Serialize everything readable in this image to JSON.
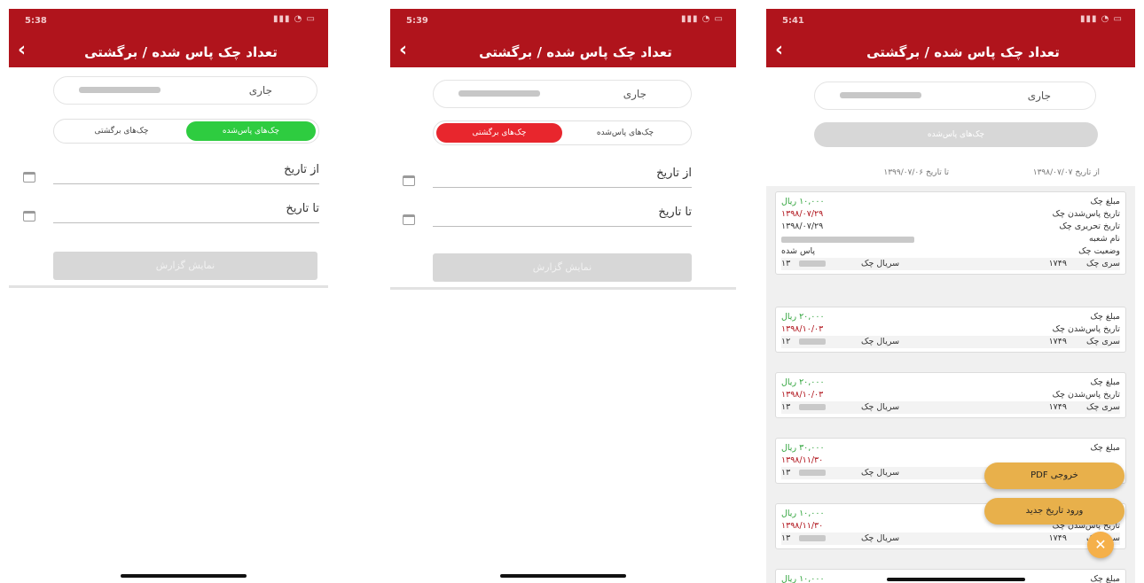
{
  "screens": [
    {
      "time": "5:38",
      "status_icons": "▮▮▮ ◔ ▭",
      "title": "تعداد چک پاس شده / برگشتی",
      "account_label": "جاری",
      "seg_passed": "چک‌های پاس‌شده",
      "seg_returned": "چک‌های برگشتی",
      "from_date": "از تاریخ",
      "to_date": "تا تاریخ",
      "show_report": "نمایش گزارش"
    },
    {
      "time": "5:39",
      "status_icons": "▮▮▮ ◔ ▭",
      "title": "تعداد چک پاس شده / برگشتی",
      "account_label": "جاری",
      "seg_passed": "چک‌های پاس‌شده",
      "seg_returned": "چک‌های برگشتی",
      "from_date": "از تاریخ",
      "to_date": "تا تاریخ",
      "show_report": "نمایش گزارش"
    },
    {
      "time": "5:41",
      "status_icons": "▮▮▮ ◔ ▭",
      "title": "تعداد چک پاس شده / برگشتی",
      "account_label": "جاری",
      "passed_button": "چک‌های پاس‌شده",
      "from_text": "از تاریخ ۱۳۹۸/۰۷/۰۷",
      "to_text": "تا تاریخ ۱۳۹۹/۰۷/۰۶",
      "cards": [
        {
          "amount_label": "مبلغ چک",
          "amount": "۱۰,۰۰۰ ریال",
          "pass_label": "تاریخ پاس‌شدن چک",
          "pass_date": "۱۳۹۸/۰۷/۲۹",
          "write_label": "تاریخ تحریری چک",
          "write_date": "۱۳۹۸/۰۷/۲۹",
          "branch_label": "نام شعبه",
          "status_label": "وضعیت چک",
          "status": "پاس شده",
          "series_label": "سری چک",
          "series": "۱۷۴۹",
          "serial_label": "سریال چک",
          "serial": "۱۳"
        },
        {
          "amount_label": "مبلغ چک",
          "amount": "۲۰,۰۰۰ ریال",
          "pass_label": "تاریخ پاس‌شدن چک",
          "pass_date": "۱۳۹۸/۱۰/۰۳",
          "series_label": "سری چک",
          "series": "۱۷۴۹",
          "serial_label": "سریال چک",
          "serial": "۱۲"
        },
        {
          "amount_label": "مبلغ چک",
          "amount": "۲۰,۰۰۰ ریال",
          "pass_label": "تاریخ پاس‌شدن چک",
          "pass_date": "۱۳۹۸/۱۰/۰۳",
          "series_label": "سری چک",
          "series": "۱۷۴۹",
          "serial_label": "سریال چک",
          "serial": "۱۳"
        },
        {
          "amount_label": "مبلغ چک",
          "amount": "۳۰,۰۰۰ ریال",
          "pass_date": "۱۳۹۸/۱۱/۳۰",
          "serial_label": "سریال چک",
          "serial": "۱۳"
        },
        {
          "amount": "۱۰,۰۰۰ ریال",
          "pass_label": "تاریخ پاس‌شدن چک",
          "pass_date": "۱۳۹۸/۱۱/۳۰",
          "series_label": "سری چک",
          "series": "۱۷۴۹",
          "serial_label": "سریال چک",
          "serial": "۱۳"
        },
        {
          "amount_label": "مبلغ چک",
          "amount": "۱۰,۰۰۰ ریال"
        }
      ],
      "fab_pdf": "خروجی PDF",
      "fab_new_date": "ورود تاریخ جدید",
      "fab_close": "✕"
    }
  ],
  "colors": {
    "header": "#b0141c",
    "green": "#2ecc40",
    "red": "#e8262d",
    "fab": "#e8b04b"
  }
}
